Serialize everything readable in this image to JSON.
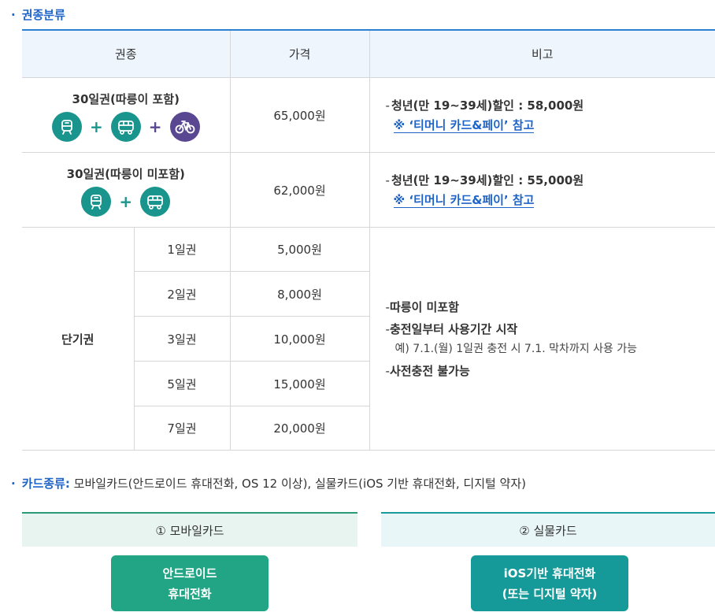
{
  "section_title": "권종분류",
  "table": {
    "headers": [
      "권종",
      "가격",
      "비고"
    ],
    "rows": [
      {
        "name": "30일권(따릉이 포함)",
        "price": "65,000원",
        "note": "청년(만 19~39세)할인 : 58,000원",
        "link": "※ ‘티머니 카드&페이’ 참고"
      },
      {
        "name": "30일권(따릉이 미포함)",
        "price": "62,000원",
        "note": "청년(만 19~39세)할인 : 55,000원",
        "link": "※ ‘티머니 카드&페이’ 참고"
      }
    ],
    "short_term": {
      "label": "단기권",
      "items": [
        {
          "days": "1일권",
          "price": "5,000원"
        },
        {
          "days": "2일권",
          "price": "8,000원"
        },
        {
          "days": "3일권",
          "price": "10,000원"
        },
        {
          "days": "5일권",
          "price": "15,000원"
        },
        {
          "days": "7일권",
          "price": "20,000원"
        }
      ],
      "notes": {
        "n1": "따릉이 미포함",
        "n2": "충전일부터 사용기간 시작",
        "n2_sub": "예) 7.1.(월) 1일권 충전 시 7.1. 막차까지 사용 가능",
        "n3": "사전충전 불가능"
      }
    }
  },
  "card_types": {
    "label": "카드종류:",
    "text": " 모바일카드(안드로이드 휴대전화, OS 12 이상), 실물카드(iOS 기반 휴대전화, 디지털 약자)"
  },
  "mobile_card": {
    "heading": "① 모바일카드",
    "button_line1": "안드로이드",
    "button_line2": "휴대전화"
  },
  "physical_card": {
    "heading": "② 실물카드",
    "button_line1": "iOS기반 휴대전화",
    "button_line2": "(또는 디지털 약자)"
  },
  "icons": [
    "subway-icon",
    "bus-icon",
    "bicycle-icon"
  ],
  "colors": {
    "accent_blue": "#1e64c8",
    "icon_green": "#19958d",
    "icon_purple": "#5a4791",
    "android_btn": "#22a584",
    "ios_btn": "#159a99"
  }
}
